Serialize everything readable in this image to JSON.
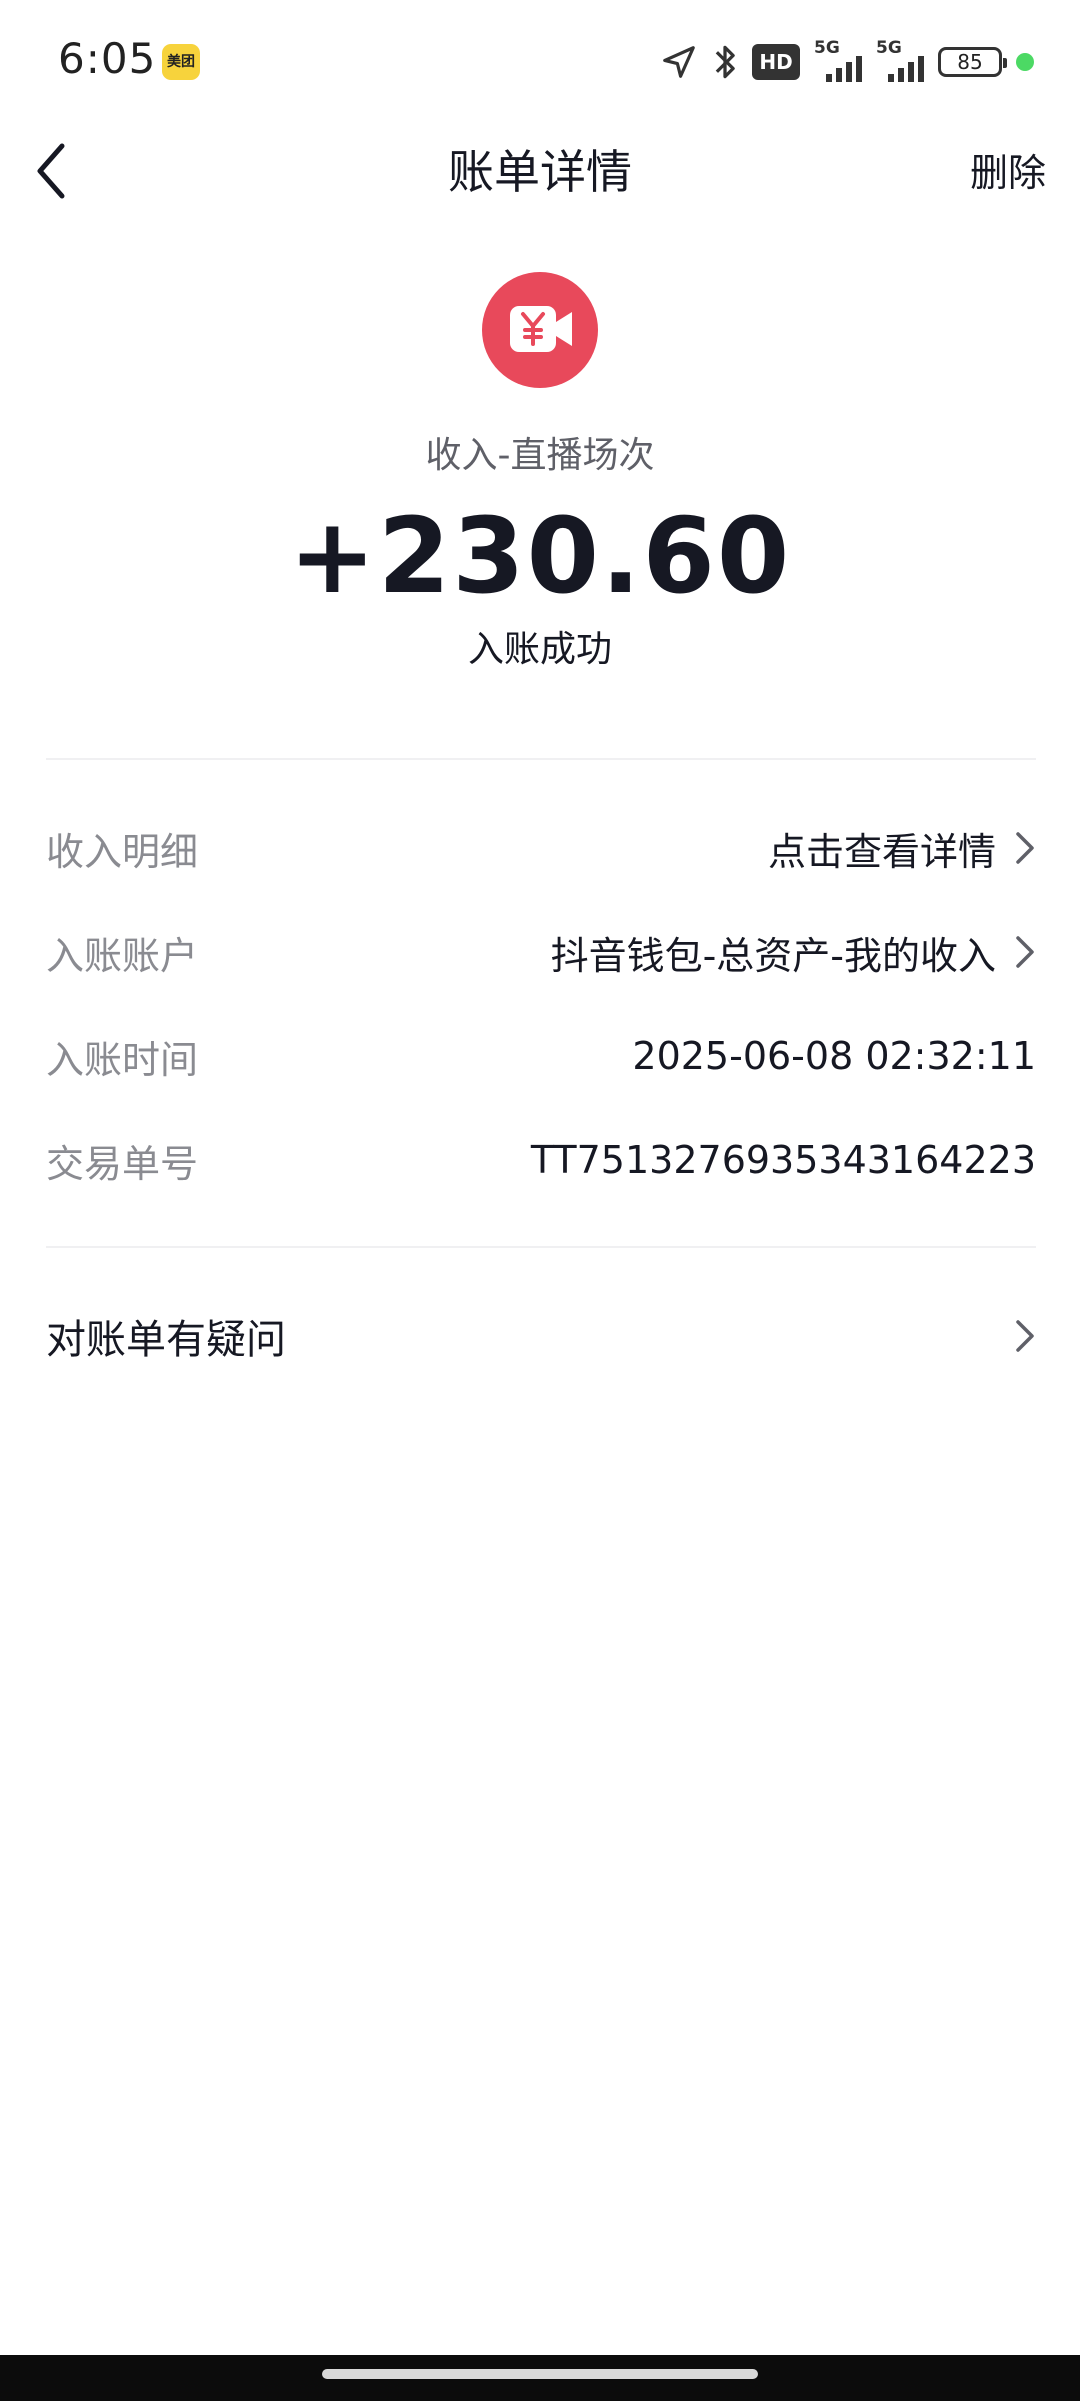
{
  "status_bar": {
    "time": "6:05",
    "app_badge": "美团",
    "hd_label": "HD",
    "network_1": "5G",
    "network_2": "5G",
    "battery": "85",
    "icons": [
      "location-arrow-icon",
      "bluetooth-icon",
      "hd-icon",
      "signal-icon",
      "signal-icon",
      "battery-icon",
      "green-dot"
    ]
  },
  "nav": {
    "title": "账单详情",
    "delete_label": "删除",
    "back_icon": "chevron-left-icon"
  },
  "header": {
    "icon": "live-video-yuan-icon",
    "icon_color": "#e8495b",
    "type_label": "收入-直播场次",
    "amount": "+230.60",
    "status": "入账成功"
  },
  "details": [
    {
      "label": "收入明细",
      "value": "点击查看详情",
      "has_arrow": true
    },
    {
      "label": "入账账户",
      "value": "抖音钱包-总资产-我的收入",
      "has_arrow": true
    },
    {
      "label": "入账时间",
      "value": "2025-06-08 02:32:11",
      "has_arrow": false
    },
    {
      "label": "交易单号",
      "value": "TT7513276935343164223",
      "has_arrow": false
    }
  ],
  "question": {
    "label": "对账单有疑问"
  }
}
